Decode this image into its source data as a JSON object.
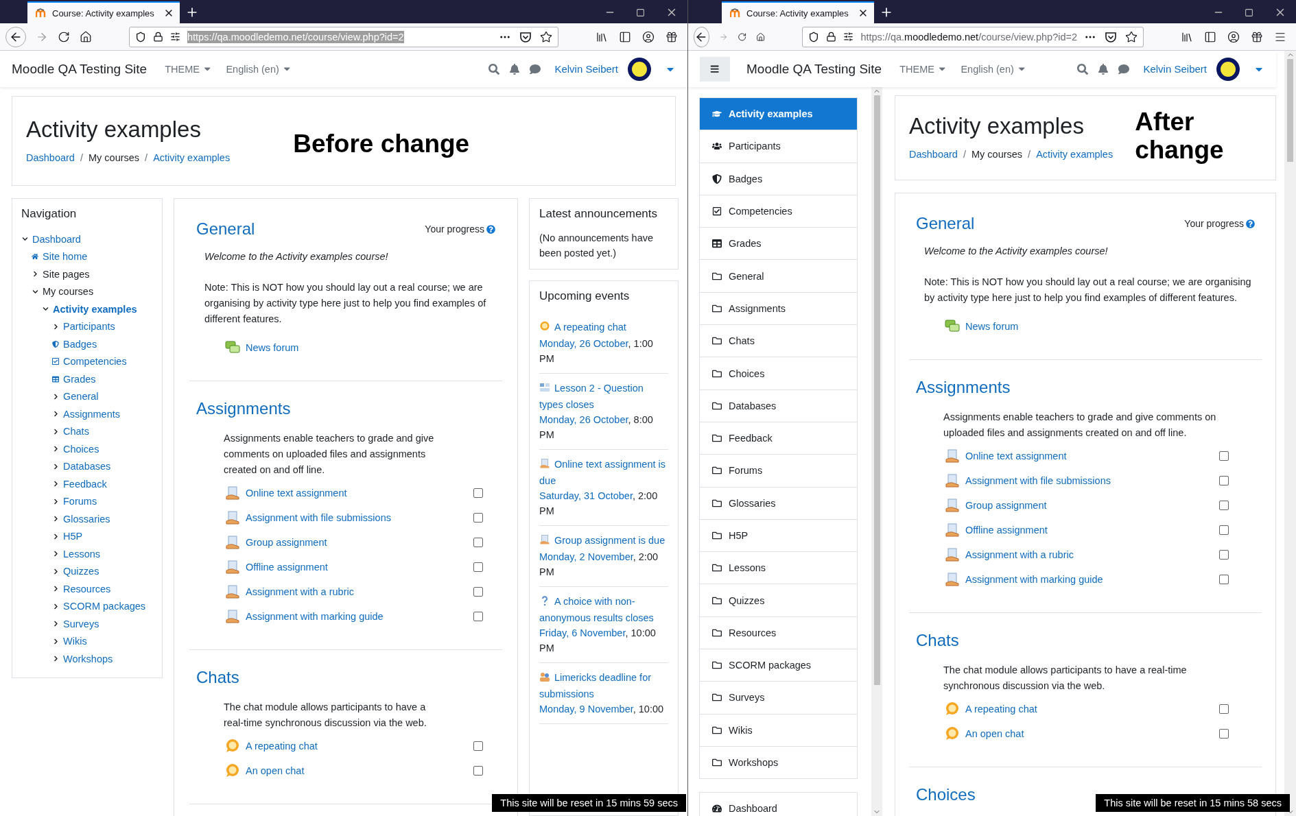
{
  "windows": [
    {
      "browser": {
        "tab_title": "Course: Activity examples",
        "url": {
          "scheme": "https://qa.",
          "domain": "moodledemo.net",
          "path": "/course/view.php?id=2",
          "selected": true
        }
      },
      "navbar": {
        "site_name": "Moodle QA Testing Site",
        "menus": [
          "THEME",
          "English (en)"
        ],
        "user": "Kelvin Seibert"
      },
      "header": {
        "title": "Activity examples",
        "separator": "/",
        "breadcrumb": [
          {
            "label": "Dashboard",
            "kind": "link"
          },
          {
            "label": "My courses",
            "kind": "text"
          },
          {
            "label": "Activity examples",
            "kind": "link"
          }
        ],
        "annotation": "Before change"
      },
      "navigation_block": {
        "title": "Navigation",
        "items": [
          {
            "label": "Dashboard",
            "kind": "link",
            "expanded": true,
            "children": [
              {
                "label": "Site home",
                "kind": "home"
              },
              {
                "label": "Site pages",
                "kind": "text",
                "expanded": false
              },
              {
                "label": "My courses",
                "kind": "text",
                "expanded": true,
                "children": [
                  {
                    "label": "Activity examples",
                    "kind": "current",
                    "expanded": true,
                    "children": [
                      {
                        "label": "Participants",
                        "kind": "link",
                        "expanded": false
                      },
                      {
                        "label": "Badges",
                        "kind": "badge"
                      },
                      {
                        "label": "Competencies",
                        "kind": "competency"
                      },
                      {
                        "label": "Grades",
                        "kind": "grades"
                      },
                      {
                        "label": "General",
                        "kind": "link",
                        "expanded": false
                      },
                      {
                        "label": "Assignments",
                        "kind": "link",
                        "expanded": false
                      },
                      {
                        "label": "Chats",
                        "kind": "link",
                        "expanded": false
                      },
                      {
                        "label": "Choices",
                        "kind": "link",
                        "expanded": false
                      },
                      {
                        "label": "Databases",
                        "kind": "link",
                        "expanded": false
                      },
                      {
                        "label": "Feedback",
                        "kind": "link",
                        "expanded": false
                      },
                      {
                        "label": "Forums",
                        "kind": "link",
                        "expanded": false
                      },
                      {
                        "label": "Glossaries",
                        "kind": "link",
                        "expanded": false
                      },
                      {
                        "label": "H5P",
                        "kind": "link",
                        "expanded": false
                      },
                      {
                        "label": "Lessons",
                        "kind": "link",
                        "expanded": false
                      },
                      {
                        "label": "Quizzes",
                        "kind": "link",
                        "expanded": false
                      },
                      {
                        "label": "Resources",
                        "kind": "link",
                        "expanded": false
                      },
                      {
                        "label": "SCORM packages",
                        "kind": "link",
                        "expanded": false
                      },
                      {
                        "label": "Surveys",
                        "kind": "link",
                        "expanded": false
                      },
                      {
                        "label": "Wikis",
                        "kind": "link",
                        "expanded": false
                      },
                      {
                        "label": "Workshops",
                        "kind": "link",
                        "expanded": false
                      }
                    ]
                  }
                ]
              }
            ]
          }
        ]
      },
      "sections": [
        {
          "title": "General",
          "progress_label": "Your progress",
          "welcome": "Welcome to the Activity examples course!",
          "note": "Note: This is NOT how you should lay out a real course; we are organising by activity type here just to help you find examples of different features.",
          "activities": [
            {
              "kind": "forum",
              "name": "News forum"
            }
          ]
        },
        {
          "title": "Assignments",
          "summary": "Assignments enable teachers to grade and give comments on uploaded files and assignments created on and off line.",
          "activities": [
            {
              "kind": "assign",
              "name": "Online text assignment",
              "checked": false
            },
            {
              "kind": "assign",
              "name": "Assignment with file submissions",
              "checked": false
            },
            {
              "kind": "assign",
              "name": "Group assignment",
              "checked": false
            },
            {
              "kind": "assign",
              "name": "Offline assignment",
              "checked": false
            },
            {
              "kind": "assign",
              "name": "Assignment with a rubric",
              "checked": false
            },
            {
              "kind": "assign",
              "name": "Assignment with marking guide",
              "checked": false
            }
          ]
        },
        {
          "title": "Chats",
          "summary": "The chat module allows participants to have a real-time synchronous discussion via the web.",
          "activities": [
            {
              "kind": "chat",
              "name": "A repeating chat",
              "checked": false
            },
            {
              "kind": "chat",
              "name": "An open chat",
              "checked": false
            }
          ]
        }
      ],
      "blocks": [
        {
          "kind": "announcements",
          "title": "Latest announcements",
          "text": "(No announcements have been posted yet.)"
        },
        {
          "kind": "events",
          "title": "Upcoming events",
          "events": [
            {
              "kind": "chat",
              "name": "A repeating chat",
              "date": "Monday, 26 October",
              "time": ", 1:00 PM"
            },
            {
              "kind": "lesson",
              "name": "Lesson 2 - Question types closes",
              "date": "Monday, 26 October",
              "time": ", 8:00 PM"
            },
            {
              "kind": "assign",
              "name": "Online text assignment is due",
              "date": "Saturday, 31 October",
              "time": ", 2:00 PM"
            },
            {
              "kind": "assign",
              "name": "Group assignment is due",
              "date": "Monday, 2 November",
              "time": ", 2:00 PM"
            },
            {
              "kind": "choice",
              "name": "A choice with non-anonymous results closes",
              "date": "Friday, 6 November",
              "time": ", 10:00 PM"
            },
            {
              "kind": "workshop",
              "name": "Limericks deadline for submissions",
              "date": "Monday, 9 November",
              "time": ", 10:00"
            }
          ]
        }
      ],
      "reset_notice": "This site will be reset in 15 mins 59 secs"
    },
    {
      "browser": {
        "tab_title": "Course: Activity examples",
        "url": {
          "scheme": "https://qa.",
          "domain": "moodledemo.net",
          "path": "/course/view.php?id=2",
          "selected": false
        }
      },
      "navbar": {
        "drawer_button": true,
        "site_name": "Moodle QA Testing Site",
        "menus": [
          "THEME",
          "English (en)"
        ],
        "user": "Kelvin Seibert"
      },
      "drawer": {
        "groups": [
          {
            "items": [
              {
                "label": "Activity examples",
                "kind": "course",
                "selected": true
              },
              {
                "label": "Participants",
                "kind": "users",
                "selected": false
              },
              {
                "label": "Badges",
                "kind": "badge",
                "selected": false
              },
              {
                "label": "Competencies",
                "kind": "competency",
                "selected": false
              },
              {
                "label": "Grades",
                "kind": "grades",
                "selected": false
              },
              {
                "label": "General",
                "kind": "folder",
                "selected": false
              },
              {
                "label": "Assignments",
                "kind": "folder",
                "selected": false
              },
              {
                "label": "Chats",
                "kind": "folder",
                "selected": false
              },
              {
                "label": "Choices",
                "kind": "folder",
                "selected": false
              },
              {
                "label": "Databases",
                "kind": "folder",
                "selected": false
              },
              {
                "label": "Feedback",
                "kind": "folder",
                "selected": false
              },
              {
                "label": "Forums",
                "kind": "folder",
                "selected": false
              },
              {
                "label": "Glossaries",
                "kind": "folder",
                "selected": false
              },
              {
                "label": "H5P",
                "kind": "folder",
                "selected": false
              },
              {
                "label": "Lessons",
                "kind": "folder",
                "selected": false
              },
              {
                "label": "Quizzes",
                "kind": "folder",
                "selected": false
              },
              {
                "label": "Resources",
                "kind": "folder",
                "selected": false
              },
              {
                "label": "SCORM packages",
                "kind": "folder",
                "selected": false
              },
              {
                "label": "Surveys",
                "kind": "folder",
                "selected": false
              },
              {
                "label": "Wikis",
                "kind": "folder",
                "selected": false
              },
              {
                "label": "Workshops",
                "kind": "folder",
                "selected": false
              }
            ]
          },
          {
            "items": [
              {
                "label": "Dashboard",
                "kind": "dashboard",
                "selected": false
              }
            ]
          }
        ]
      },
      "header": {
        "title": "Activity examples",
        "separator": "/",
        "breadcrumb": [
          {
            "label": "Dashboard",
            "kind": "link"
          },
          {
            "label": "My courses",
            "kind": "text"
          },
          {
            "label": "Activity examples",
            "kind": "link"
          }
        ],
        "annotation": "After change"
      },
      "sections": [
        {
          "title": "General",
          "progress_label": "Your progress",
          "welcome": "Welcome to the Activity examples course!",
          "note": "Note: This is NOT how you should lay out a real course; we are organising by activity type here just to help you find examples of different features.",
          "activities": [
            {
              "kind": "forum",
              "name": "News forum"
            }
          ]
        },
        {
          "title": "Assignments",
          "summary": "Assignments enable teachers to grade and give comments on uploaded files and assignments created on and off line.",
          "activities": [
            {
              "kind": "assign",
              "name": "Online text assignment",
              "checked": false
            },
            {
              "kind": "assign",
              "name": "Assignment with file submissions",
              "checked": false
            },
            {
              "kind": "assign",
              "name": "Group assignment",
              "checked": false
            },
            {
              "kind": "assign",
              "name": "Offline assignment",
              "checked": false
            },
            {
              "kind": "assign",
              "name": "Assignment with a rubric",
              "checked": false
            },
            {
              "kind": "assign",
              "name": "Assignment with marking guide",
              "checked": false
            }
          ]
        },
        {
          "title": "Chats",
          "summary": "The chat module allows participants to have a real-time synchronous discussion via the web.",
          "activities": [
            {
              "kind": "chat",
              "name": "A repeating chat",
              "checked": false
            },
            {
              "kind": "chat",
              "name": "An open chat",
              "checked": false
            }
          ]
        },
        {
          "title": "Choices"
        }
      ],
      "reset_notice": "This site will be reset in 15 mins 58 secs"
    }
  ]
}
